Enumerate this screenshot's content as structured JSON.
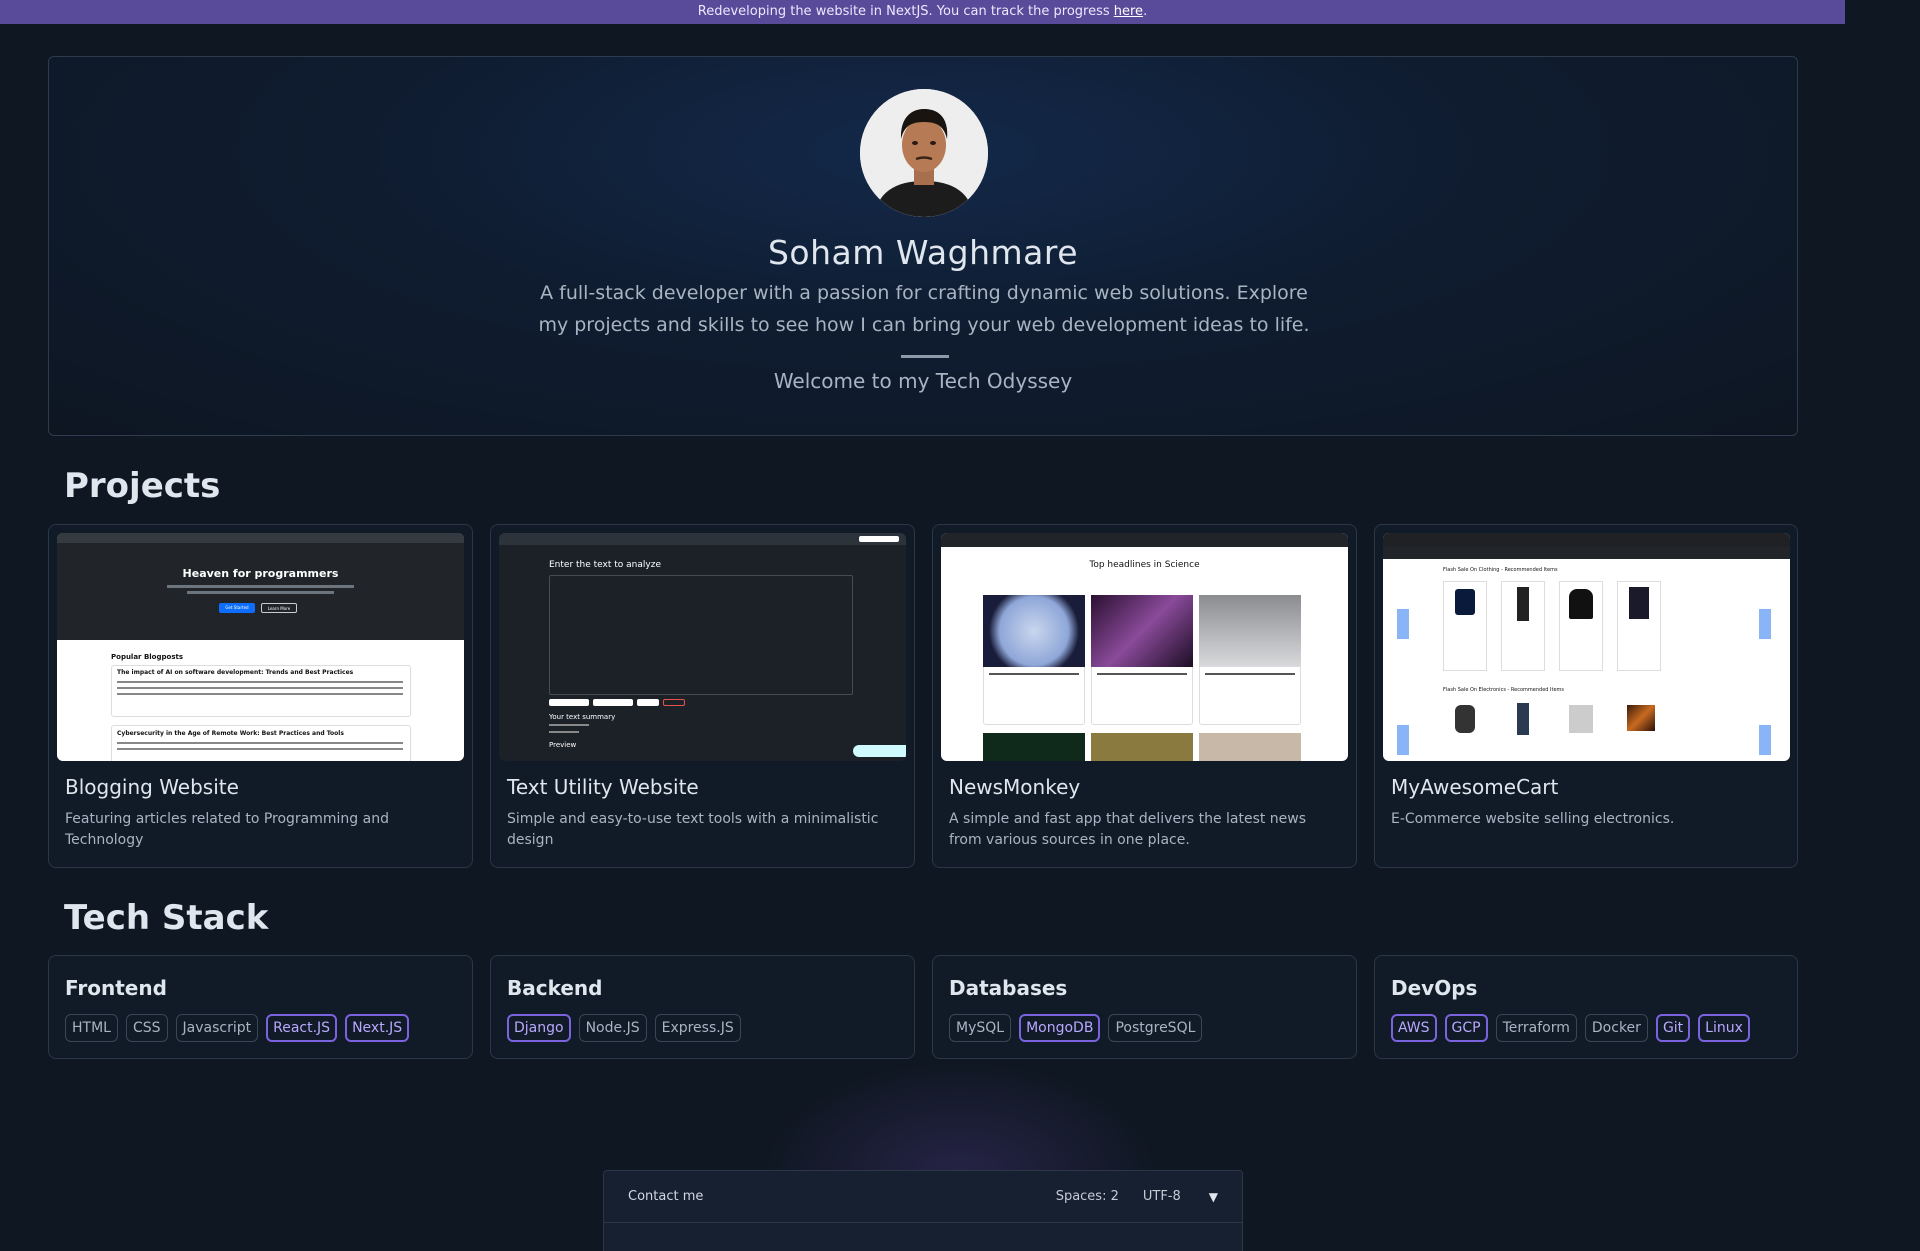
{
  "banner": {
    "text": "Redeveloping the website in NextJS. You can track the progress ",
    "link": "here",
    "suffix": "."
  },
  "hero": {
    "name": "Soham Waghmare",
    "tagline": "A full-stack developer with a passion for crafting dynamic web solutions. Explore my projects and skills to see how I can bring your web development ideas to life.",
    "welcome": "Welcome to my Tech Odyssey"
  },
  "projects": {
    "title": "Projects",
    "items": [
      {
        "title": "Blogging Website",
        "desc": "Featuring articles related to Programming and Technology",
        "shot": {
          "hero": "Heaven for programmers",
          "section": "Popular Blogposts",
          "post1": "The impact of AI on software development: Trends and Best Practices",
          "post2": "Cybersecurity in the Age of Remote Work: Best Practices and Tools",
          "btn1": "Get Started",
          "btn2": "Learn More"
        }
      },
      {
        "title": "Text Utility Website",
        "desc": "Simple and easy-to-use text tools with a minimalistic design",
        "shot": {
          "heading": "Enter the text to analyze",
          "summary": "Your text summary",
          "preview": "Preview"
        }
      },
      {
        "title": "NewsMonkey",
        "desc": "A simple and fast app that delivers the latest news from various sources in one place.",
        "shot": {
          "heading": "Top headlines in Science"
        }
      },
      {
        "title": "MyAwesomeCart",
        "desc": "E-Commerce website selling electronics.",
        "shot": {
          "row1": "Flash Sale On Clothing - Recommended Items",
          "row2": "Flash Sale On Electronics - Recommended Items"
        }
      }
    ]
  },
  "tech": {
    "title": "Tech Stack",
    "groups": [
      {
        "title": "Frontend",
        "chips": [
          "HTML",
          "CSS",
          "Javascript",
          "React.JS",
          "Next.JS"
        ]
      },
      {
        "title": "Backend",
        "chips": [
          "Django",
          "Node.JS",
          "Express.JS"
        ]
      },
      {
        "title": "Databases",
        "chips": [
          "MySQL",
          "MongoDB",
          "PostgreSQL"
        ]
      },
      {
        "title": "DevOps",
        "chips": [
          "AWS",
          "GCP",
          "Terraform",
          "Docker",
          "Git",
          "Linux"
        ]
      }
    ]
  },
  "contact": {
    "title": "Contact me",
    "spaces": "Spaces: 2",
    "encoding": "UTF-8"
  },
  "colors": {
    "accent": "#7b63e0",
    "banner": "#5a4a9a",
    "background": "#0f1722"
  }
}
